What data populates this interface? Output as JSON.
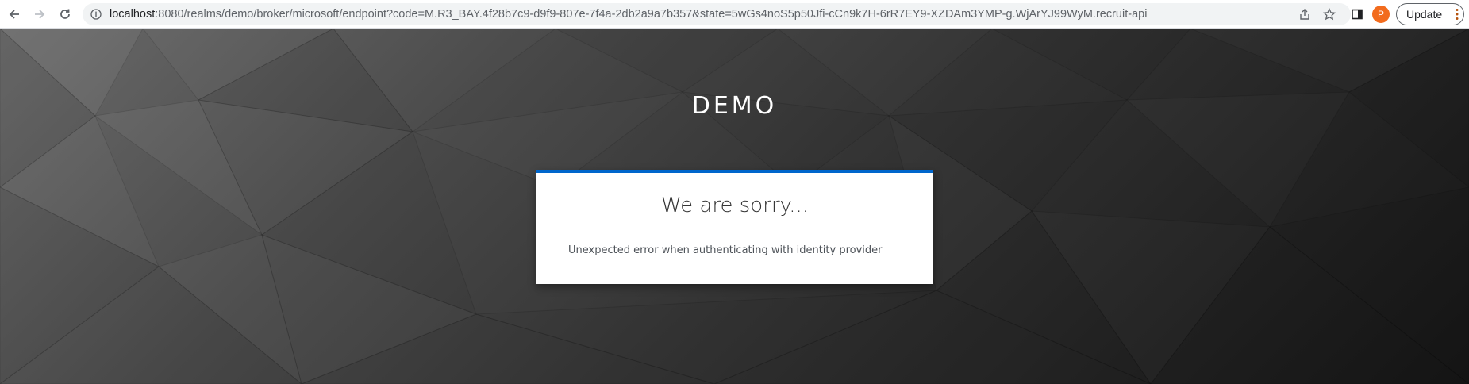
{
  "browser": {
    "url_host": "localhost",
    "url_rest": ":8080/realms/demo/broker/microsoft/endpoint?code=M.R3_BAY.4f28b7c9-d9f9-807e-7f4a-2db2a9a7b357&state=5wGs4noS5p50Jfi-cCn9k7H-6rR7EY9-XZDAm3YMP-g.WjArYJ99WyM.recruit-api",
    "avatar_letter": "P",
    "update_label": "Update"
  },
  "page": {
    "realm_title": "DEMO",
    "error_title": "We are sorry...",
    "error_message": "Unexpected error when authenticating with identity provider"
  },
  "colors": {
    "accent": "#0066cc",
    "avatar": "#f26b1d"
  }
}
